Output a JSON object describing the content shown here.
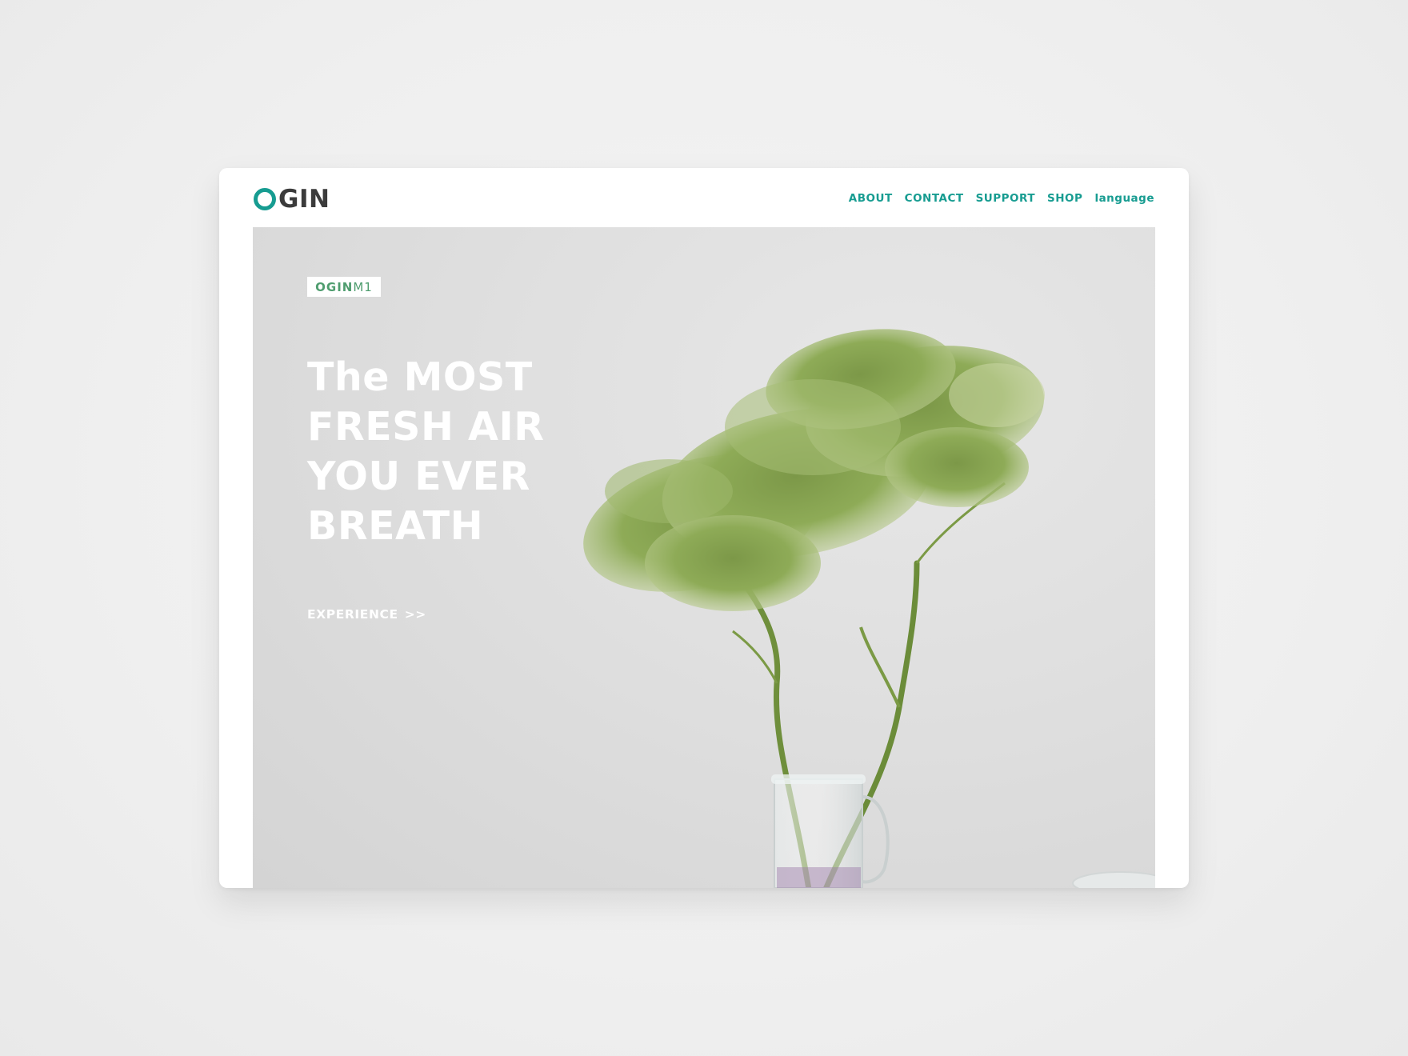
{
  "header": {
    "logo_text": "GIN",
    "nav": [
      "ABOUT",
      "CONTACT",
      "SUPPORT",
      "SHOP",
      "language"
    ]
  },
  "hero": {
    "badge_brand": "OGIN",
    "badge_model": "M1",
    "headline_lines": [
      "The MOST",
      "FRESH AIR",
      "YOU EVER",
      "BREATH"
    ],
    "cta_label": "EXPERIENCE",
    "cta_arrows": ">>"
  },
  "colors": {
    "accent": "#169c91",
    "badge_text": "#4f9d6f",
    "logo_dark": "#3b3b3b",
    "hero_bg": "#dfdfdf",
    "plant_green": "#8fae5c"
  },
  "icons": {
    "logo_mark": "ring-o-icon",
    "plant_image": "flower-vase-illustration"
  }
}
